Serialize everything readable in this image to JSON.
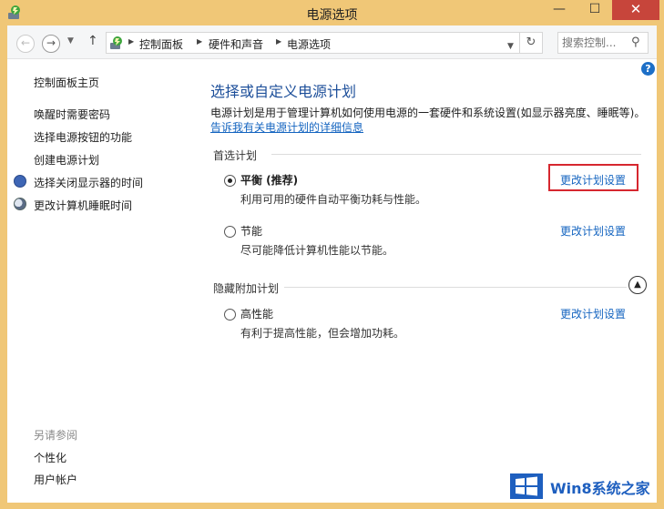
{
  "window": {
    "title": "电源选项",
    "minimize": "—",
    "maximize": "☐",
    "close": "✕"
  },
  "nav": {
    "back": "←",
    "forward": "→",
    "history_drop": "▼",
    "up": "↑",
    "breadcrumbs": [
      "控制面板",
      "硬件和声音",
      "电源选项"
    ],
    "sep": "▶",
    "address_drop": "▼",
    "refresh": "↻",
    "search_placeholder": "搜索控制...",
    "search_glyph": "⚲"
  },
  "help": "?",
  "sidebar": {
    "home": "控制面板主页",
    "items": [
      {
        "label": "唤醒时需要密码",
        "icon": ""
      },
      {
        "label": "选择电源按钮的功能",
        "icon": ""
      },
      {
        "label": "创建电源计划",
        "icon": ""
      },
      {
        "label": "选择关闭显示器的时间",
        "icon": "clock-icon"
      },
      {
        "label": "更改计算机睡眠时间",
        "icon": "moon-icon"
      }
    ],
    "see_also": "另请参阅",
    "see_also_items": [
      "个性化",
      "用户帐户"
    ]
  },
  "main": {
    "heading": "选择或自定义电源计划",
    "description": "电源计划是用于管理计算机如何使用电源的一套硬件和系统设置(如显示器亮度、睡眠等)。",
    "details_link": "告诉我有关电源计划的详细信息",
    "preferred_section": "首选计划",
    "hidden_section": "隐藏附加计划",
    "collapse_glyph": "▲",
    "change_label": "更改计划设置",
    "plans": [
      {
        "name": "平衡 (推荐)",
        "description": "利用可用的硬件自动平衡功耗与性能。",
        "selected": true
      },
      {
        "name": "节能",
        "description": "尽可能降低计算机性能以节能。",
        "selected": false
      },
      {
        "name": "高性能",
        "description": "有利于提高性能，但会增加功耗。",
        "selected": false
      }
    ]
  },
  "watermark": {
    "text": "Win8系统之家",
    "color": "#1e5fbf"
  },
  "colors": {
    "frame": "#f0c777",
    "link": "#1565c0",
    "heading": "#1d4f9a",
    "highlight": "#d6272f",
    "close": "#c7453b"
  }
}
